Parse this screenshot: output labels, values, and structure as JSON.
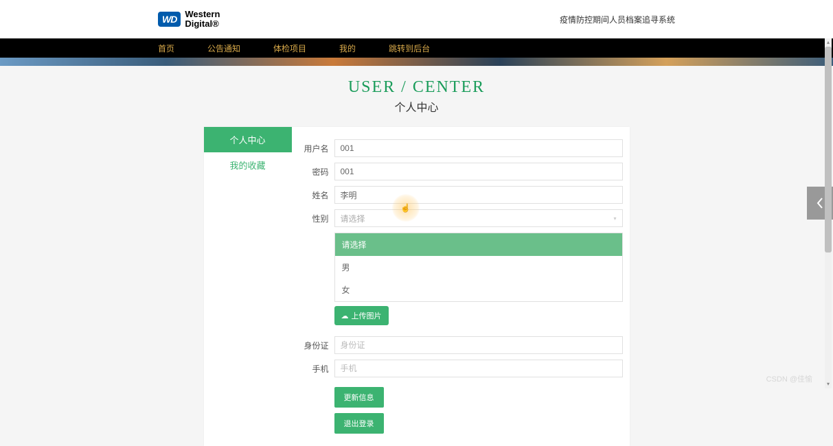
{
  "header": {
    "logo_badge": "WD",
    "logo_text_line1": "Western",
    "logo_text_line2": "Digital",
    "tagline": "疫情防控期间人员档案追寻系统"
  },
  "nav": {
    "items": [
      "首页",
      "公告通知",
      "体检项目",
      "我的",
      "跳转到后台"
    ]
  },
  "page_title": {
    "en": "USER / CENTER",
    "zh": "个人中心"
  },
  "sidebar": {
    "items": [
      {
        "label": "个人中心",
        "active": true
      },
      {
        "label": "我的收藏",
        "active": false
      }
    ]
  },
  "form": {
    "username": {
      "label": "用户名",
      "value": "001"
    },
    "password": {
      "label": "密码",
      "value": "001"
    },
    "name": {
      "label": "姓名",
      "value": "李明"
    },
    "gender": {
      "label": "性别",
      "placeholder": "请选择"
    },
    "gender_options": [
      {
        "label": "请选择",
        "selected": true
      },
      {
        "label": "男",
        "selected": false
      },
      {
        "label": "女",
        "selected": false
      }
    ],
    "upload_btn": "上传图片",
    "idcard": {
      "label": "身份证",
      "placeholder": "身份证"
    },
    "phone": {
      "label": "手机",
      "placeholder": "手机"
    },
    "update_btn": "更新信息",
    "logout_btn": "退出登录"
  },
  "watermark": "CSDN @佳愉"
}
